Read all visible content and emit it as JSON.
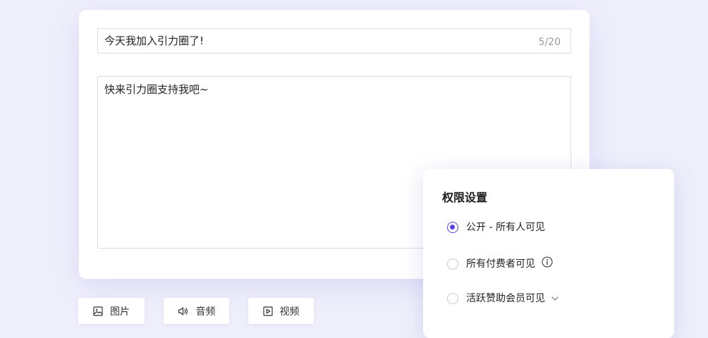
{
  "editor": {
    "title_value": "今天我加入引力圈了!",
    "title_counter": "5/20",
    "body_value": "快来引力圈支持我吧~"
  },
  "media_buttons": [
    {
      "label": "图片",
      "icon": "image-icon"
    },
    {
      "label": "音频",
      "icon": "speaker-icon"
    },
    {
      "label": "视频",
      "icon": "play-icon"
    }
  ],
  "permissions": {
    "title": "权限设置",
    "options": [
      {
        "label": "公开 - 所有人可见",
        "selected": true
      },
      {
        "label": "所有付费者可见",
        "selected": false,
        "icon": "info-icon"
      },
      {
        "label": "活跃赞助会员可见",
        "selected": false,
        "icon": "chevron-down-icon"
      }
    ]
  },
  "colors": {
    "accent": "#5b3fe6",
    "background": "#efeffb"
  }
}
